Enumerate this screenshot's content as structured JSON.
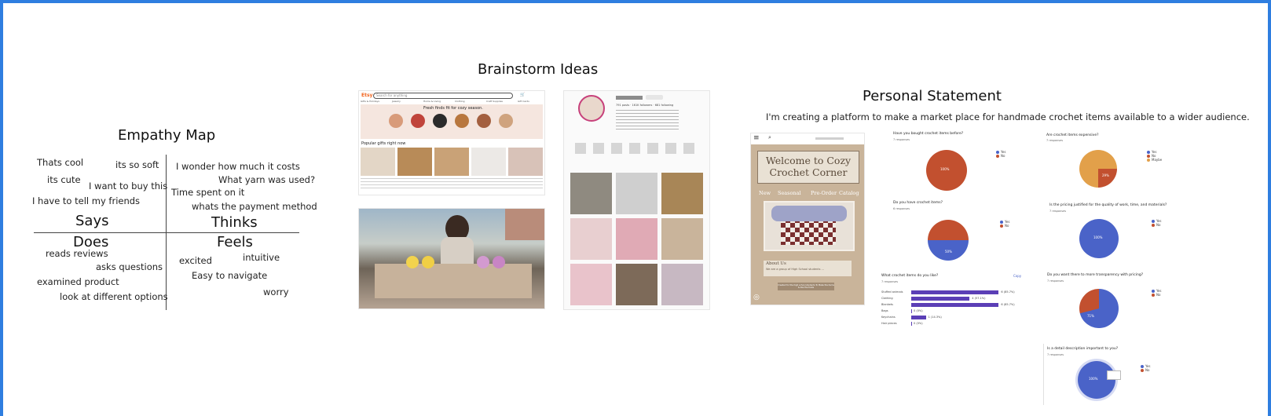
{
  "empathy": {
    "title": "Empathy Map",
    "says": [
      "Thats cool",
      "its so soft",
      "its cute",
      "I want to buy this",
      "I have to tell my friends"
    ],
    "thinks": [
      "I wonder how much it costs",
      "What yarn was used?",
      "Time spent on it",
      "whats the payment method"
    ],
    "does": [
      "reads reviews",
      "asks questions",
      "examined product",
      "look at different options"
    ],
    "feels": [
      "excited",
      "intuitive",
      "Easy to navigate",
      "worry"
    ],
    "quadrants": {
      "says": "Says",
      "thinks": "Thinks",
      "does": "Does",
      "feels": "Feels"
    }
  },
  "brainstorm": {
    "title": "Brainstorm Ideas",
    "etsy": {
      "logo": "Etsy",
      "search_placeholder": "Search for anything",
      "banner": "Fresh finds fit for cozy season.",
      "section": "Popular gifts right now",
      "nav": [
        "Gifts & Holidays",
        "Jewelry",
        "Home & Living",
        "Clothing",
        "Craft Supplies",
        "Gift Cards"
      ]
    },
    "profile": {
      "stats": [
        "791 posts",
        "161K followers",
        "681 following"
      ]
    }
  },
  "statement": {
    "title": "Personal Statement",
    "text": "I'm creating a platform to make a market place for handmade crochet items available to a wider audience.",
    "mockup": {
      "heading": "Welcome to Cozy Crochet Corner",
      "nav": [
        "New",
        "Seasonal",
        "Pre-Order",
        "Catalog"
      ],
      "about_title": "About Us",
      "about_text": "We are a group of High School students ...",
      "footer_btn": "Created for the high school students To Make the items & like the trade"
    },
    "survey": [
      {
        "q": "Have you bought crochet items before?",
        "n": "7 responses",
        "slice": "100%"
      },
      {
        "q": "Are crochet items expensive?",
        "n": "7 responses",
        "slice": "29%"
      },
      {
        "q": "Do you have crochet items?",
        "n": "6 responses",
        "slice": "50%"
      },
      {
        "q": "Is the pricing justified for the quality of work, time, and materials?",
        "n": "7 responses",
        "slice": "100%"
      },
      {
        "q": "What crochet items do you like?",
        "n": "7 responses"
      },
      {
        "q": "Do you want there to more transparency with pricing?",
        "n": "7 responses",
        "slice": "71%"
      },
      {
        "q": "Is a detail description important to you?",
        "n": "7 responses",
        "slice": "100%"
      }
    ],
    "legend": [
      "Yes",
      "No",
      "Maybe"
    ],
    "bars": [
      {
        "label": "Stuffed animals",
        "value": "6 (85.7%)"
      },
      {
        "label": "Clothing",
        "value": "4 (57.1%)"
      },
      {
        "label": "Blankets",
        "value": "6 (85.7%)"
      },
      {
        "label": "Bags",
        "value": "0 (0%)"
      },
      {
        "label": "Keychains",
        "value": "1 (14.3%)"
      },
      {
        "label": "Hair pieces",
        "value": "0 (0%)"
      }
    ],
    "copy_label": "Copy"
  },
  "colors": {
    "frame": "#2f7ee0",
    "pie_red": "#c2502f",
    "pie_blue": "#4a63c8",
    "pie_orange": "#e2a04a",
    "bar": "#5b3fb6"
  }
}
